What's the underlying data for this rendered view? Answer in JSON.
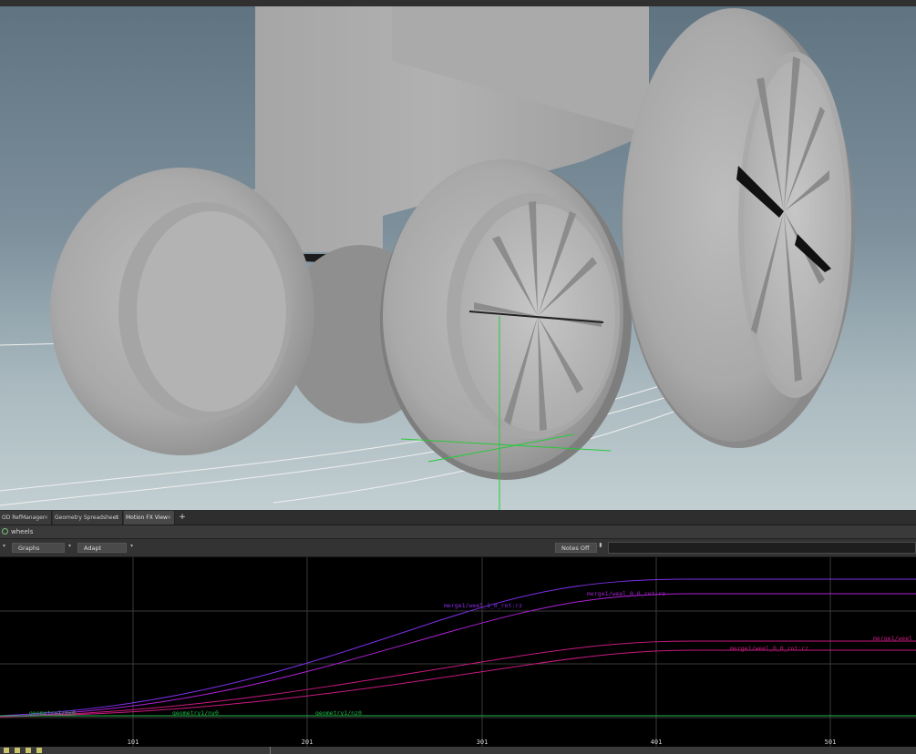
{
  "tabs": [
    {
      "label": "OD RefManager",
      "close": "×",
      "active": false
    },
    {
      "label": "Geometry Spreadsheet",
      "close": "×",
      "active": false
    },
    {
      "label": "Motion FX View",
      "close": "×",
      "active": true
    }
  ],
  "tab_add_label": "+",
  "path": {
    "node": "wheels"
  },
  "toolbar": {
    "view_dropdown": "Graphs",
    "scale_dropdown": "Adapt",
    "notes_button": "Notes Off",
    "notes_stepper": "⬍",
    "dropdown_arrow": "▾"
  },
  "graph": {
    "x_ticks": [
      "101",
      "201",
      "301",
      "401",
      "501"
    ],
    "curve_labels": [
      "merge1/weel_1_0_rot:rz",
      "merge1/weel_0_0_rot:rz",
      "merge1/weel",
      "merge1/weel_0_0_rot:rz",
      "geometry1/nx0",
      "geometry1/ny0",
      "geometry1/nz0"
    ],
    "colors": {
      "purple": "#8a2be2",
      "magenta": "#c21a8f",
      "green": "#1fb84a",
      "grid": "#3a3a3a"
    }
  },
  "icons": [
    "node-icon",
    "dropdown-arrow-icon",
    "close-icon",
    "add-tab-icon"
  ]
}
